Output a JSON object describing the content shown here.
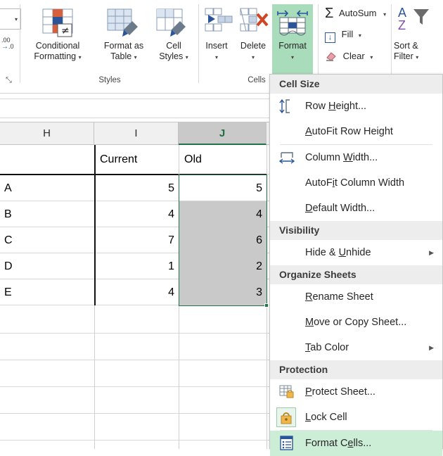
{
  "ribbon": {
    "number_group": {
      "decimal_icon": "decrease-decimal-icon",
      "decimal_top": ".00",
      "decimal_bottom": ".0",
      "dialog_launcher": "⤡",
      "caret": "▾"
    },
    "styles_group": {
      "label": "Styles",
      "buttons": [
        {
          "line1": "Conditional",
          "line2": "Formatting",
          "caret": "▾",
          "icon": "conditional-formatting-icon"
        },
        {
          "line1": "Format as",
          "line2": "Table",
          "caret": "▾",
          "icon": "format-as-table-icon"
        },
        {
          "line1": "Cell",
          "line2": "Styles",
          "caret": "▾",
          "icon": "cell-styles-icon"
        }
      ]
    },
    "cells_group": {
      "label": "Cells",
      "buttons": [
        {
          "label": "Insert",
          "caret": "▾",
          "icon": "insert-cells-icon"
        },
        {
          "label": "Delete",
          "caret": "▾",
          "icon": "delete-cells-icon"
        },
        {
          "label": "Format",
          "caret": "▾",
          "icon": "format-cells-icon",
          "highlighted": true
        }
      ]
    },
    "editing_group": {
      "autosum": {
        "label": "AutoSum",
        "symbol": "Σ",
        "caret": "▾"
      },
      "fill": {
        "label": "Fill",
        "symbol": "↓",
        "caret": "▾"
      },
      "clear": {
        "label": "Clear",
        "symbol": "eraser-icon",
        "caret": "▾"
      },
      "sort_filter": {
        "line1": "Sort &",
        "line2": "Filter",
        "caret": "▾",
        "letter_a": "A",
        "letter_z": "Z",
        "funnel": "funnel-icon"
      }
    }
  },
  "sheet": {
    "columns": [
      {
        "letter": "H",
        "selected": false
      },
      {
        "letter": "I",
        "selected": false
      },
      {
        "letter": "J",
        "selected": true
      }
    ],
    "header_row": {
      "h": "",
      "i": "Current",
      "j": "Old"
    },
    "rows": [
      {
        "label": "A",
        "current": "5",
        "old": "5",
        "old_selected_fill": false
      },
      {
        "label": "B",
        "current": "4",
        "old": "4",
        "old_selected_fill": true
      },
      {
        "label": "C",
        "current": "7",
        "old": "6",
        "old_selected_fill": true
      },
      {
        "label": "D",
        "current": "1",
        "old": "2",
        "old_selected_fill": true
      },
      {
        "label": "E",
        "current": "4",
        "old": "3",
        "old_selected_fill": true
      }
    ],
    "selection_color": "#217346",
    "selection_fill": "#C9C9C9"
  },
  "menu": {
    "sections": [
      {
        "title": "Cell Size",
        "items": [
          {
            "label_pre": "Row ",
            "label_key": "H",
            "label_post": "eight...",
            "icon": "row-height-icon",
            "arrow": ""
          },
          {
            "label_pre": "",
            "label_key": "A",
            "label_post": "utoFit Row Height",
            "icon": "",
            "arrow": "",
            "separator_after": true
          },
          {
            "label_pre": "Column ",
            "label_key": "W",
            "label_post": "idth...",
            "icon": "column-width-icon",
            "arrow": ""
          },
          {
            "label_pre": "AutoF",
            "label_key": "i",
            "label_post": "t Column Width",
            "icon": "",
            "arrow": ""
          },
          {
            "label_pre": "",
            "label_key": "D",
            "label_post": "efault Width...",
            "icon": "",
            "arrow": ""
          }
        ]
      },
      {
        "title": "Visibility",
        "items": [
          {
            "label_pre": "Hide & ",
            "label_key": "U",
            "label_post": "nhide",
            "icon": "",
            "arrow": "▶"
          }
        ]
      },
      {
        "title": "Organize Sheets",
        "items": [
          {
            "label_pre": "",
            "label_key": "R",
            "label_post": "ename Sheet",
            "icon": "",
            "arrow": ""
          },
          {
            "label_pre": "",
            "label_key": "M",
            "label_post": "ove or Copy Sheet...",
            "icon": "",
            "arrow": ""
          },
          {
            "label_pre": "",
            "label_key": "T",
            "label_post": "ab Color",
            "icon": "",
            "arrow": "▶"
          }
        ]
      },
      {
        "title": "Protection",
        "items": [
          {
            "label_pre": "",
            "label_key": "P",
            "label_post": "rotect Sheet...",
            "icon": "protect-sheet-icon",
            "arrow": ""
          },
          {
            "label_pre": "",
            "label_key": "L",
            "label_post": "ock Cell",
            "icon": "lock-cell-icon",
            "arrow": "",
            "icon_toggled": true,
            "separator_after": true
          },
          {
            "label_pre": "Format C",
            "label_key": "e",
            "label_post": "lls...",
            "icon": "format-cells-dialog-icon",
            "arrow": "",
            "hovered": true
          }
        ]
      }
    ]
  },
  "colors": {
    "accent_green": "#217346",
    "highlight_green": "#A8DCBA",
    "hover_green": "#CDEED6",
    "section_header_gray": "#EDEDED",
    "selected_cell_gray": "#C9C9C9",
    "col_header_gray": "#F0F0F0"
  }
}
